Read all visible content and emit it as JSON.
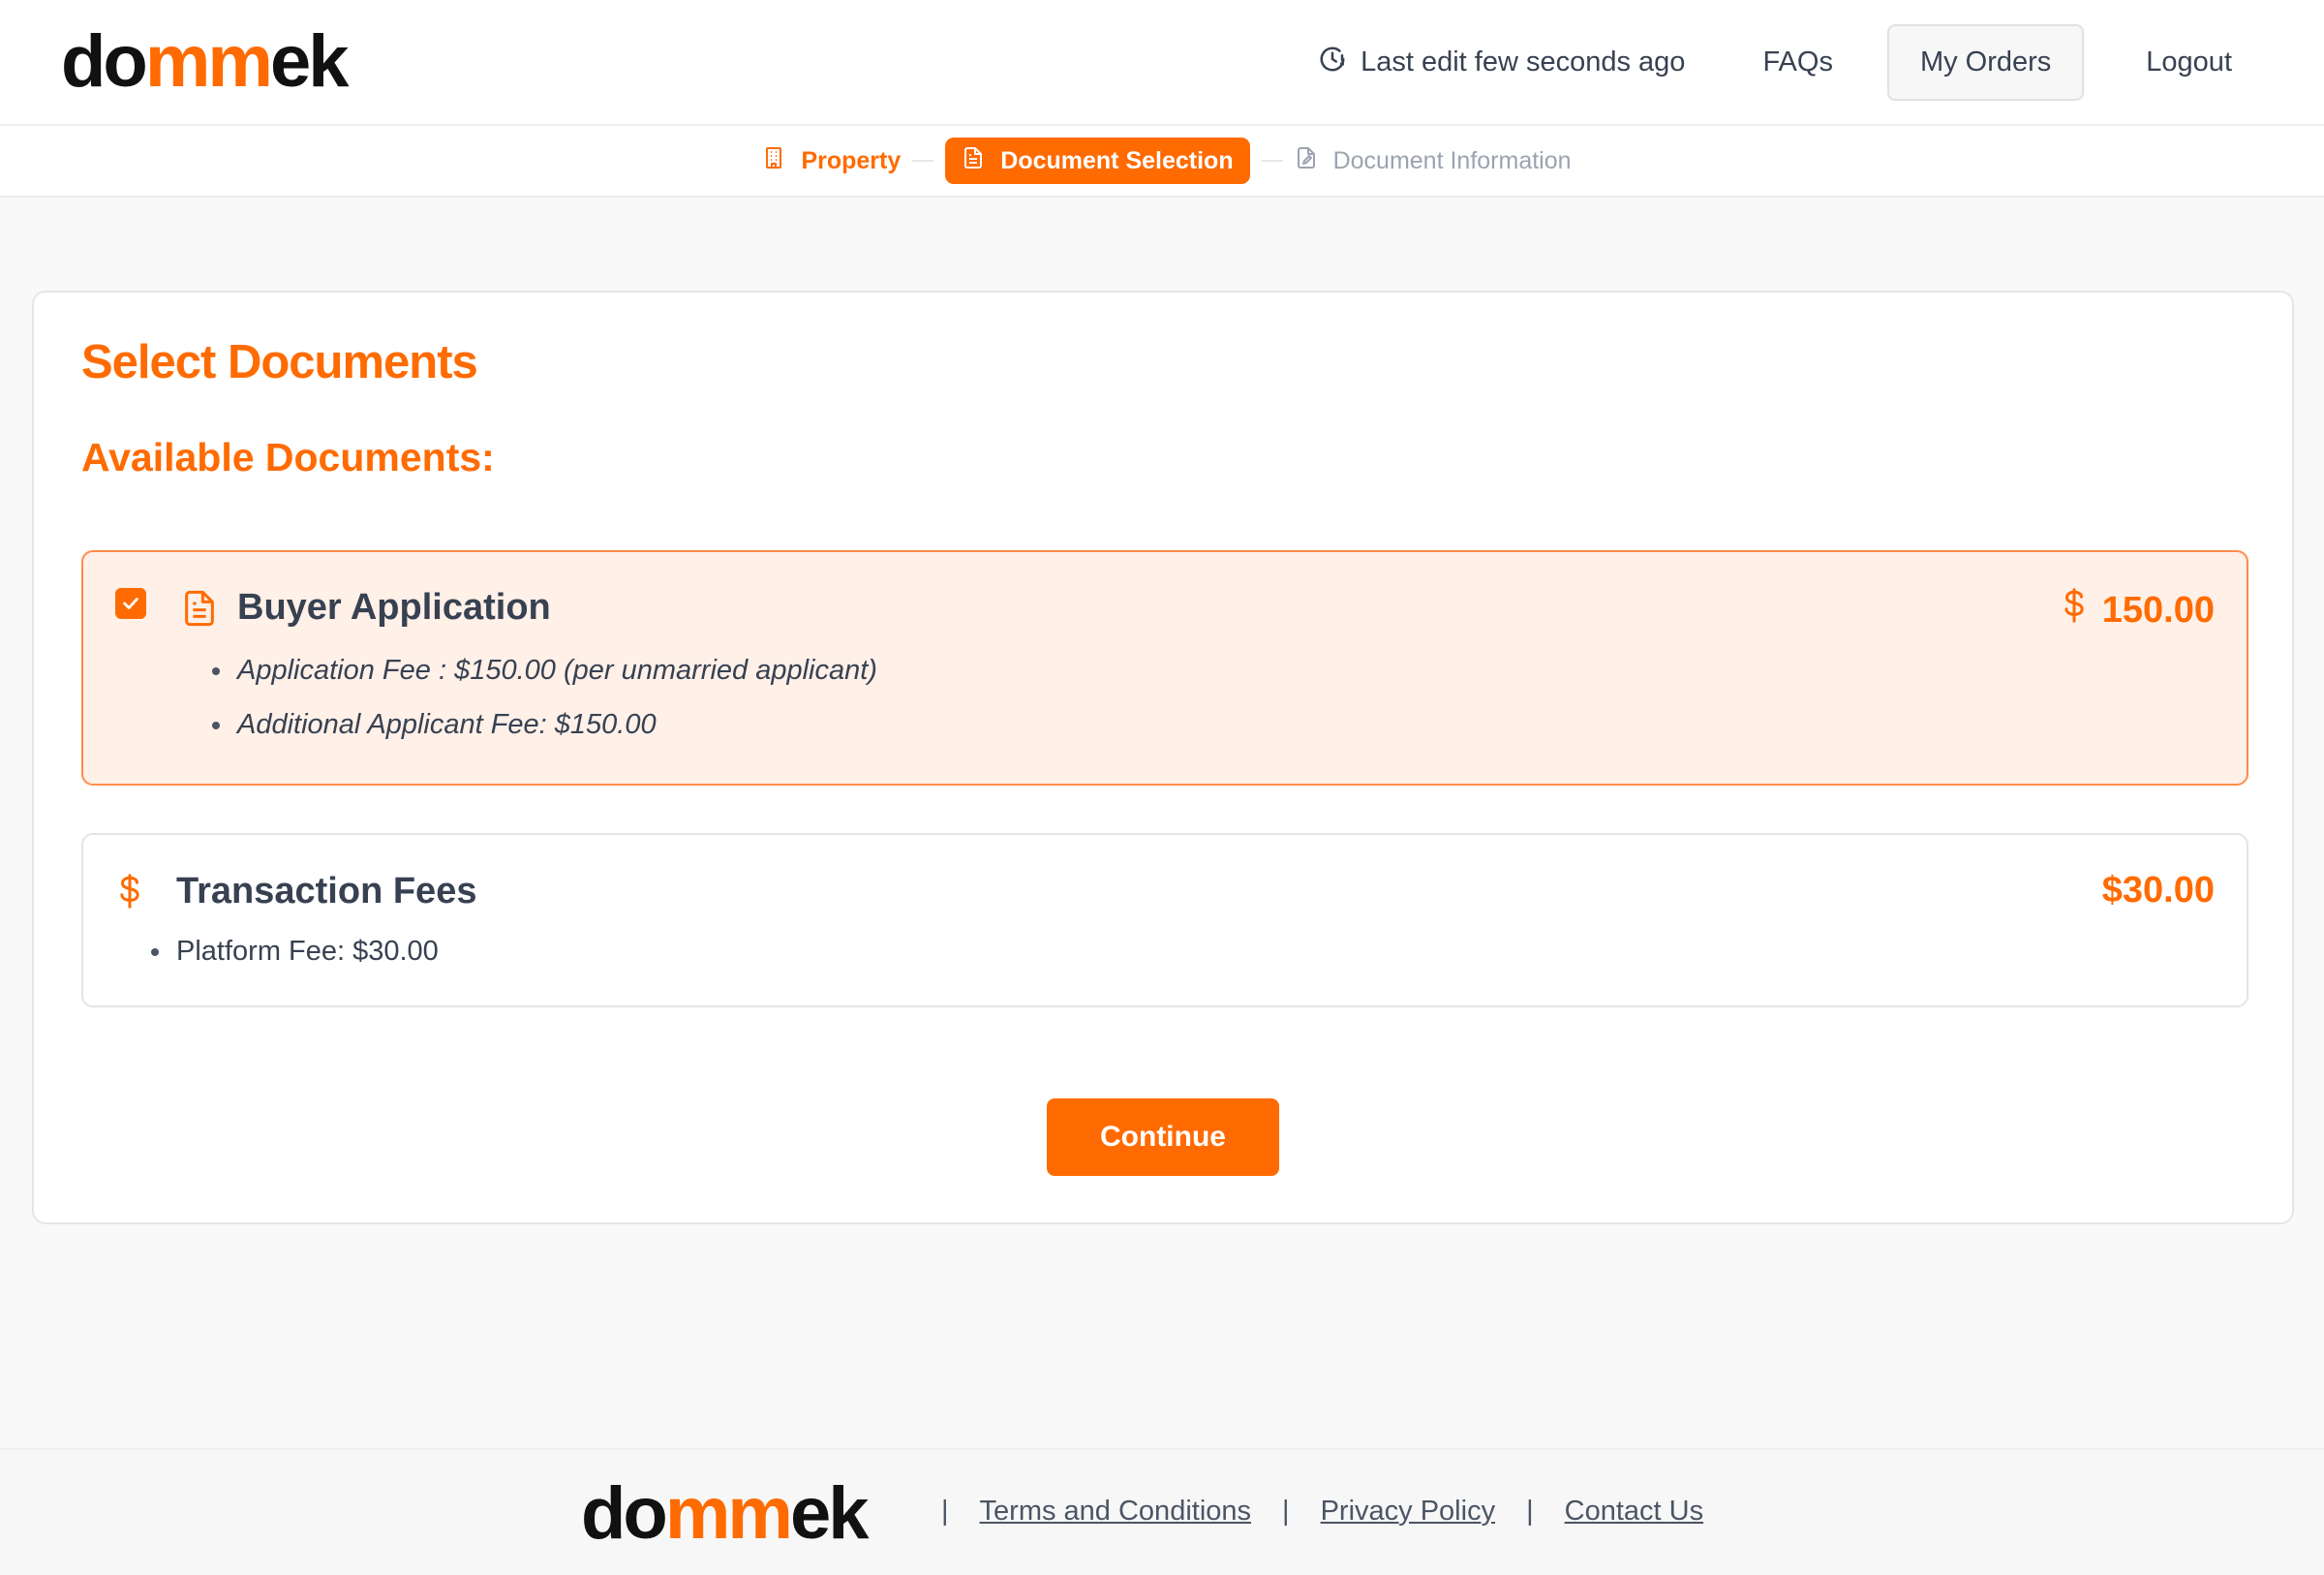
{
  "header": {
    "logo": {
      "part1": "do",
      "part2": "mm",
      "part3": "ek"
    },
    "last_edit": "Last edit few seconds ago",
    "faqs": "FAQs",
    "my_orders": "My Orders",
    "logout": "Logout"
  },
  "steps": [
    {
      "label": "Property",
      "state": "done",
      "icon": "building-icon"
    },
    {
      "label": "Document Selection",
      "state": "active",
      "icon": "document-icon"
    },
    {
      "label": "Document Information",
      "state": "pending",
      "icon": "document-edit-icon"
    }
  ],
  "main": {
    "title": "Select Documents",
    "subtitle": "Available Documents:",
    "documents": [
      {
        "name": "Buyer Application",
        "price_amount": "150.00",
        "checked": true,
        "icon": "document-icon",
        "details": [
          "Application Fee : $150.00 (per unmarried applicant)",
          "Additional Applicant Fee: $150.00"
        ]
      }
    ],
    "fees": {
      "name": "Transaction Fees",
      "price": "$30.00",
      "icon": "dollar-icon",
      "details": [
        "Platform Fee: $30.00"
      ]
    },
    "continue_label": "Continue"
  },
  "footer": {
    "links": [
      "Terms and Conditions",
      "Privacy Policy",
      "Contact Us"
    ],
    "separator": "|"
  },
  "colors": {
    "accent": "#ff6b00",
    "selected_bg": "#fff0e8",
    "text": "#374151",
    "muted": "#9ca3af"
  }
}
